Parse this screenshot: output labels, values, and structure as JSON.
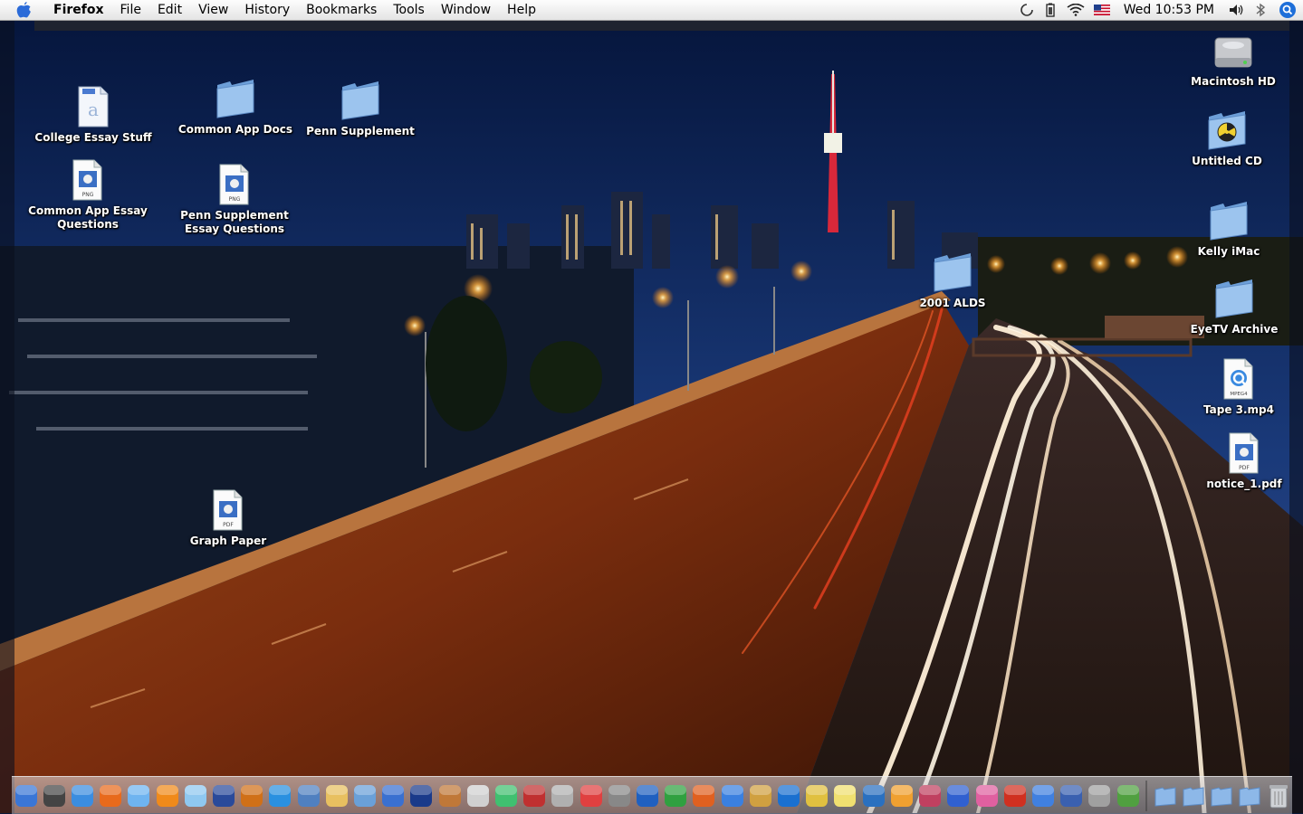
{
  "menubar": {
    "app_name": "Firefox",
    "menus": [
      "File",
      "Edit",
      "View",
      "History",
      "Bookmarks",
      "Tools",
      "Window",
      "Help"
    ],
    "clock": "Wed 10:53 PM",
    "status_icons": [
      "sync-icon",
      "battery-icon",
      "wifi-icon",
      "us-flag-icon",
      "volume-icon",
      "bluetooth-icon",
      "spotlight-icon"
    ]
  },
  "desktop": {
    "icons": [
      {
        "label": "College Essay Stuff",
        "icon": "document-icon"
      },
      {
        "label": "Common App Docs",
        "icon": "folder-icon"
      },
      {
        "label": "Penn Supplement",
        "icon": "folder-icon"
      },
      {
        "label": "Common App Essay Questions",
        "icon": "png-file-icon"
      },
      {
        "label": "Penn Supplement Essay Questions",
        "icon": "png-file-icon"
      },
      {
        "label": "Graph Paper",
        "icon": "pdf-file-icon"
      },
      {
        "label": "2001 ALDS",
        "icon": "folder-icon"
      },
      {
        "label": "Macintosh HD",
        "icon": "hard-drive-icon"
      },
      {
        "label": "Untitled CD",
        "icon": "cd-icon"
      },
      {
        "label": "Kelly iMac",
        "icon": "folder-icon"
      },
      {
        "label": "EyeTV Archive",
        "icon": "folder-icon"
      },
      {
        "label": "Tape 3.mp4",
        "icon": "mpeg4-file-icon"
      },
      {
        "label": "notice_1.pdf",
        "icon": "pdf-file-icon"
      }
    ],
    "file_badges": {
      "png": "PNG",
      "pdf": "PDF",
      "mpeg4": "MPEG4"
    }
  },
  "dock": {
    "apps": [
      "finder",
      "dashboard",
      "safari",
      "firefox",
      "itunes",
      "vlc",
      "network",
      "eyetv",
      "audio",
      "quicktime",
      "preview",
      "text-editor",
      "photo",
      "netnewswire",
      "imovie",
      "garageband",
      "ipod",
      "color",
      "dictionary",
      "calculator",
      "ical",
      "mac",
      "word",
      "excel",
      "powerpoint",
      "messenger",
      "script",
      "cyberduck",
      "ical-2",
      "stickies",
      "mail-app",
      "photo-2",
      "pages",
      "pen",
      "flower",
      "pdf-reader",
      "transfer",
      "network-2",
      "system",
      "vnc"
    ],
    "trash_label": "trash"
  },
  "colors": {
    "menubar_top": "#fdfdfd",
    "menubar_bottom": "#e4e4e4",
    "sky_top": "#0a1f4f",
    "road": "#7a3010",
    "folder": "#8db8e8",
    "spotlight": "#1e6fd9"
  }
}
